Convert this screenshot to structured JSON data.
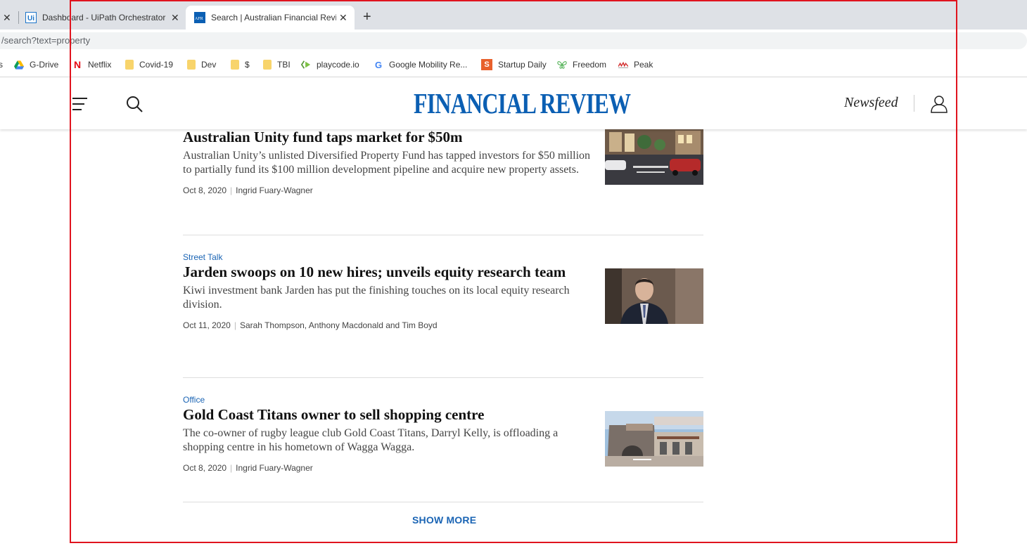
{
  "browser": {
    "tabs": [
      {
        "title": "",
        "active": false
      },
      {
        "title": "Dashboard - UiPath Orchestrator",
        "favicon": "uipath-icon",
        "active": false
      },
      {
        "title": "Search | Australian Financial Revie",
        "favicon": "afr-icon",
        "favicon_text": "AFR",
        "active": true
      }
    ],
    "url": "/search?text=property",
    "bookmarks": [
      {
        "label": "",
        "icon": "apps-icon"
      },
      {
        "label": "G-Drive",
        "icon": "gdrive-icon"
      },
      {
        "label": "Netflix",
        "icon": "netflix-icon",
        "icon_text": "N"
      },
      {
        "label": "Covid-19",
        "icon": "folder-icon"
      },
      {
        "label": "Dev",
        "icon": "folder-icon"
      },
      {
        "label": "$",
        "icon": "folder-icon"
      },
      {
        "label": "TBI",
        "icon": "folder-icon"
      },
      {
        "label": "playcode.io",
        "icon": "playcode-icon"
      },
      {
        "label": "Google Mobility Re...",
        "icon": "google-icon",
        "icon_text": "G"
      },
      {
        "label": "Startup Daily",
        "icon": "startup-daily-icon",
        "icon_text": "S"
      },
      {
        "label": "Freedom",
        "icon": "freedom-icon"
      },
      {
        "label": "Peak",
        "icon": "peak-icon"
      }
    ]
  },
  "site": {
    "logo": "FINANCIAL REVIEW",
    "newsfeed": "Newsfeed",
    "brand_color": "#0b5fb3"
  },
  "articles": [
    {
      "category": "",
      "headline": "Australian Unity fund taps market for $50m",
      "summary": "Australian Unity’s unlisted Diversified Property Fund has tapped investors for $50 million to partially fund its $100 million development pipeline and acquire new property assets.",
      "date": "Oct 8, 2020",
      "author": "Ingrid Fuary-Wagner"
    },
    {
      "category": "Street Talk",
      "headline": "Jarden swoops on 10 new hires; unveils equity research team",
      "summary": "Kiwi investment bank Jarden has put the finishing touches on its local equity research division.",
      "date": "Oct 11, 2020",
      "author": "Sarah Thompson, Anthony Macdonald and Tim Boyd"
    },
    {
      "category": "Office",
      "headline": "Gold Coast Titans owner to sell shopping centre",
      "summary": "The co-owner of rugby league club Gold Coast Titans, Darryl Kelly, is offloading a shopping centre in his hometown of Wagga Wagga.",
      "date": "Oct 8, 2020",
      "author": "Ingrid Fuary-Wagner"
    }
  ],
  "show_more": "SHOW MORE",
  "colors": {
    "link": "#1a64b4",
    "annotation_frame": "#e0141e"
  }
}
